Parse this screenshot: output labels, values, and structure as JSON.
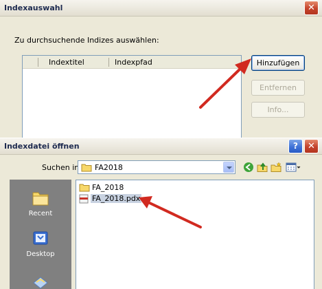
{
  "index_dialog": {
    "title": "Indexauswahl",
    "instruction": "Zu durchsuchende Indizes auswählen:",
    "columns": [
      "Indextitel",
      "Indexpfad"
    ],
    "buttons": {
      "add": "Hinzufügen",
      "remove": "Entfernen",
      "info": "Info..."
    },
    "close_icon": "close-icon"
  },
  "open_dialog": {
    "title": "Indexdatei öffnen",
    "help_label": "?",
    "look_in_label": "Suchen in:",
    "look_in_value": "FA2018",
    "places": [
      {
        "label": "Recent",
        "icon": "recent-folder-icon"
      },
      {
        "label": "Desktop",
        "icon": "desktop-icon"
      },
      {
        "label": "",
        "icon": "documents-icon"
      }
    ],
    "files": [
      {
        "name": "FA_2018",
        "icon": "folder-icon",
        "selected": false
      },
      {
        "name": "FA_2018.pdx",
        "icon": "pdx-file-icon",
        "selected": true
      }
    ],
    "toolbar_icons": [
      "back-icon",
      "up-folder-icon",
      "new-folder-icon",
      "view-menu-icon"
    ]
  },
  "colors": {
    "arrow": "#d12a20",
    "title_text": "#1d2a4f",
    "places_bg": "#808080",
    "selection": "#c8d2e1"
  }
}
